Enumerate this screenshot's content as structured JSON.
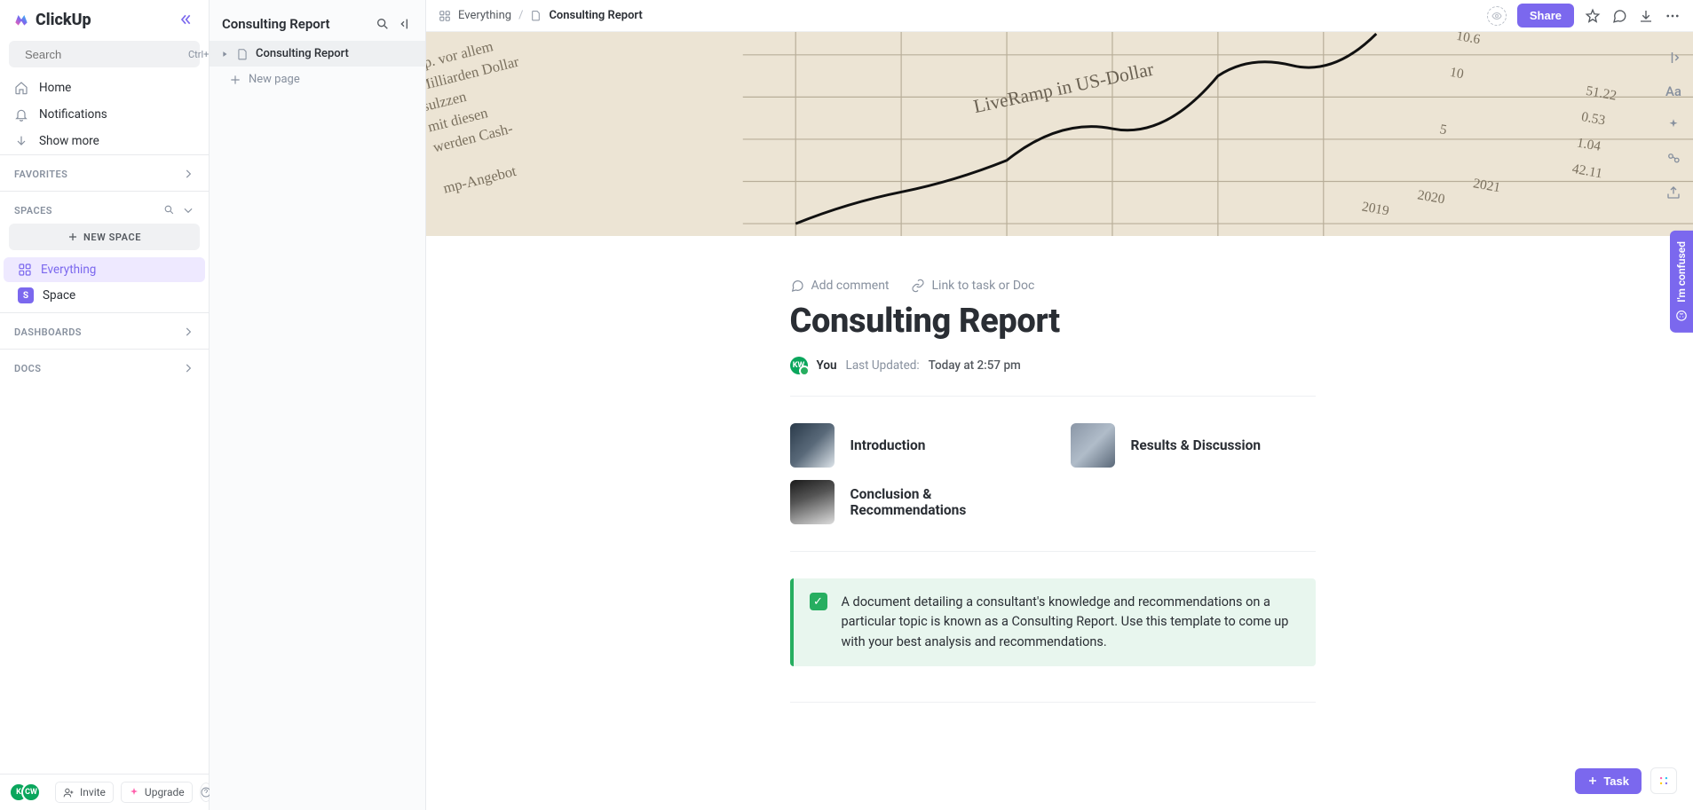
{
  "brand": "ClickUp",
  "sidebar": {
    "search_placeholder": "Search",
    "search_kbd": "Ctrl+K",
    "nav": {
      "home": "Home",
      "notifications": "Notifications",
      "show_more": "Show more"
    },
    "favorites_label": "FAVORITES",
    "spaces_label": "SPACES",
    "new_space": "NEW SPACE",
    "everything": "Everything",
    "space": "Space",
    "space_initial": "S",
    "dashboards_label": "DASHBOARDS",
    "docs_label": "DOCS",
    "invite": "Invite",
    "upgrade": "Upgrade",
    "avatar1": "K",
    "avatar2": "CW"
  },
  "docpanel": {
    "title": "Consulting Report",
    "item": "Consulting Report",
    "new_page": "New page"
  },
  "topbar": {
    "crumb1": "Everything",
    "crumb2": "Consulting Report",
    "share": "Share"
  },
  "doc": {
    "add_comment": "Add comment",
    "link_task": "Link to task or Doc",
    "title": "Consulting Report",
    "author": "You",
    "author_initials": "KW",
    "updated_label": "Last Updated:",
    "updated_value": "Today at 2:57 pm",
    "sections": {
      "intro": "Introduction",
      "results": "Results & Discussion",
      "conclusion": "Conclusion & Recommendations"
    },
    "callout": "A document detailing a consultant's knowledge and recommendations on a particular topic is known as a Consulting Report. Use this template to come up with your best analysis and recommendations."
  },
  "right": {
    "confused": "I'm confused",
    "aa": "Aa"
  },
  "fab": {
    "task": "Task"
  }
}
